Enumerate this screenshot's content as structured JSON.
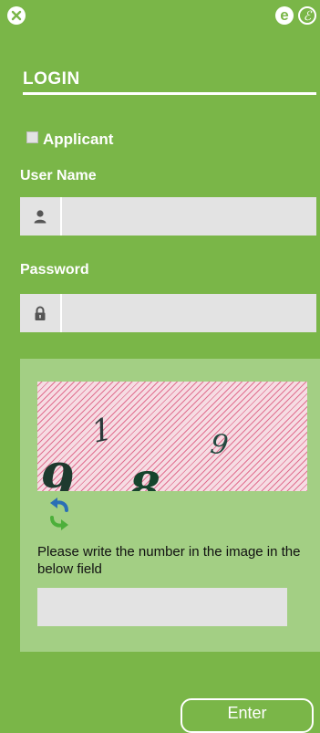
{
  "header": {
    "close_icon": "close-circle-icon",
    "e_icon_text": "e",
    "e_outline_icon_text": "ℰ"
  },
  "login": {
    "title": "LOGIN",
    "applicant_label": "Applicant",
    "applicant_checked": false
  },
  "username": {
    "label": "User Name",
    "icon": "user-icon",
    "value": "",
    "placeholder": ""
  },
  "password": {
    "label": "Password",
    "icon": "lock-icon",
    "value": "",
    "placeholder": ""
  },
  "captcha": {
    "digits": [
      "1",
      "8",
      "9",
      "9"
    ],
    "refresh_icon": "refresh-icon",
    "help_text": "Please write the number in the image in the below field",
    "value": "",
    "placeholder": ""
  },
  "actions": {
    "enter_label": "Enter"
  },
  "colors": {
    "background": "#7ab648",
    "panel": "#a3cf84",
    "field": "#e3e3e3",
    "text_light": "#ffffff",
    "captcha_hatch": "#e07090"
  }
}
